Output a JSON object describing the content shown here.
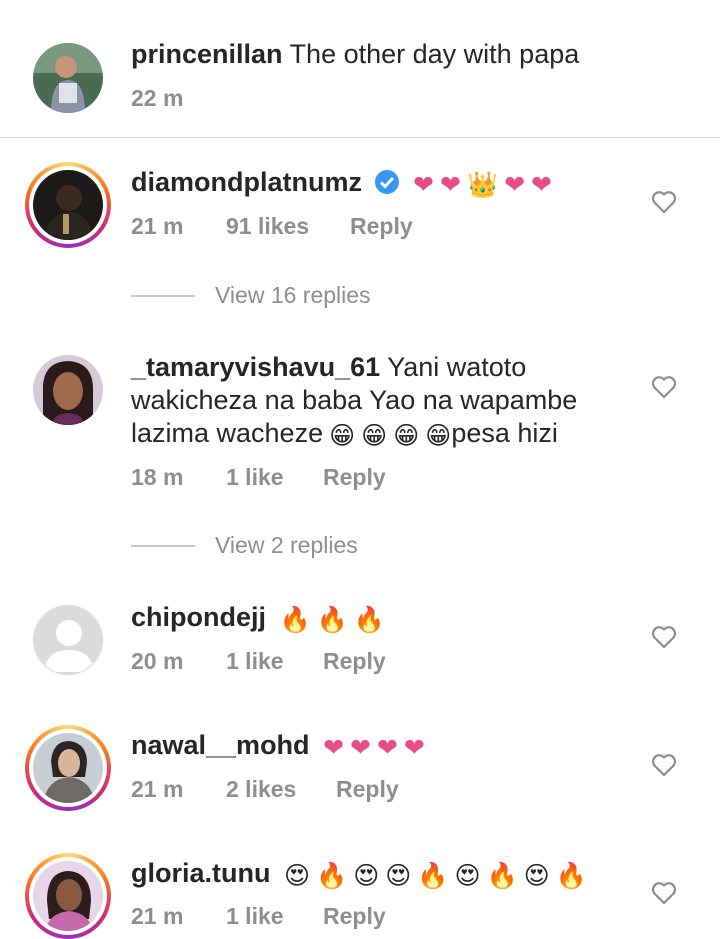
{
  "caption": {
    "username": "princenillan",
    "text": "The other day with papa",
    "time": "22 m"
  },
  "comments": [
    {
      "username": "diamondplatnumz",
      "verified": true,
      "emojis": [
        "❤",
        "❤",
        "👑",
        "❤",
        "❤"
      ],
      "time": "21 m",
      "likes": "91 likes",
      "reply": "Reply",
      "view_replies": "View 16 replies"
    },
    {
      "username": "_tamaryvishavu_61",
      "text_a": "Yani watoto wakicheza na baba Yao na wapambe lazima wacheze",
      "emojis": [
        "😁",
        "😁",
        "😁",
        "😁"
      ],
      "text_b": "pesa hizi",
      "time": "18 m",
      "likes": "1 like",
      "reply": "Reply",
      "view_replies": "View 2 replies"
    },
    {
      "username": "chipondejj",
      "emojis": [
        "🔥",
        "🔥",
        "🔥"
      ],
      "time": "20 m",
      "likes": "1 like",
      "reply": "Reply"
    },
    {
      "username": "nawal__mohd",
      "emojis": [
        "❤",
        "❤",
        "❤",
        "❤"
      ],
      "time": "21 m",
      "likes": "2 likes",
      "reply": "Reply"
    },
    {
      "username": "gloria.tunu",
      "emojis": [
        "😍",
        "🔥",
        "😍",
        "😍",
        "🔥",
        "😍",
        "🔥",
        "😍",
        "🔥"
      ],
      "time": "21 m",
      "likes": "1 like",
      "reply": "Reply"
    }
  ],
  "icons": {
    "like": "heart-outline-icon",
    "verified": "verified-badge-icon"
  },
  "colors": {
    "meta_text": "#8e8e8e",
    "verified": "#3897f0",
    "heart_emoji": "#e84d8a"
  }
}
